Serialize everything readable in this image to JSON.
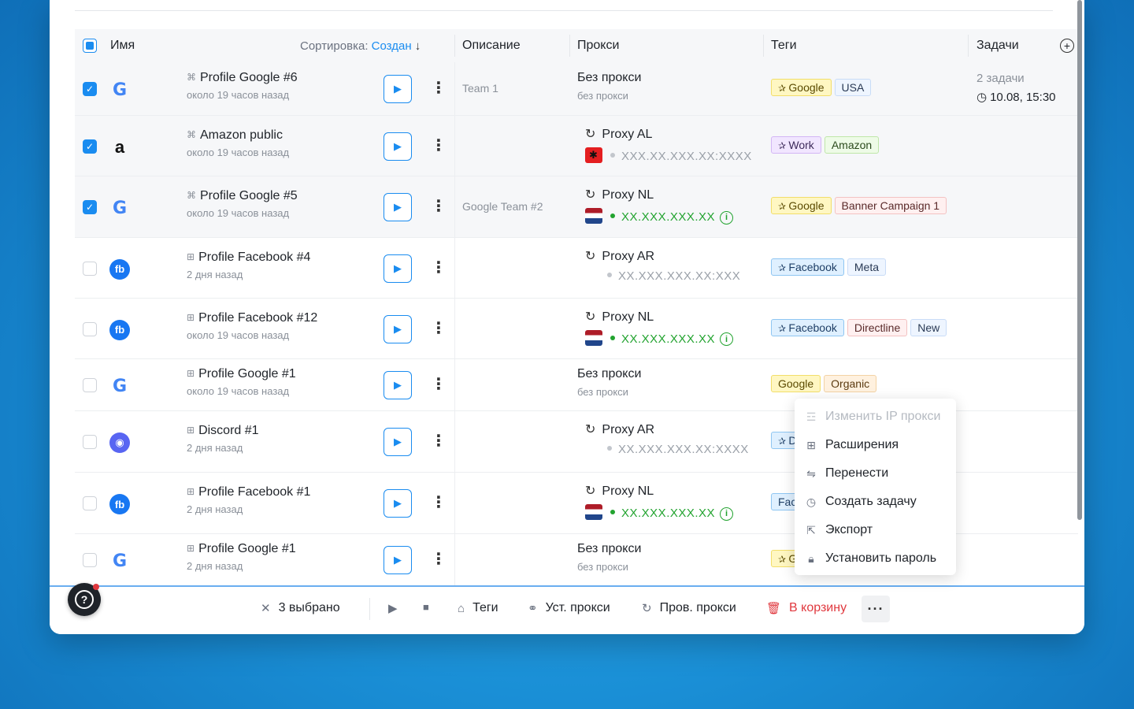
{
  "header": {
    "name": "Имя",
    "sort_label": "Сортировка:",
    "sort_value": "Создан",
    "sort_arrow": "↓",
    "description": "Описание",
    "proxy": "Прокси",
    "tags": "Теги",
    "tasks": "Задачи"
  },
  "rows": [
    {
      "checked": true,
      "logo": "google",
      "os": "mac",
      "name": "Profile Google #6",
      "time": "около 19 часов назад",
      "desc": "Team 1",
      "proxy_type": "none",
      "proxy_title": "Без прокси",
      "proxy_sub": "без прокси",
      "tags": [
        {
          "label": "Google",
          "pin": true,
          "color": "yellow"
        },
        {
          "label": "USA",
          "pin": false,
          "color": "blue"
        }
      ],
      "tasks_count": "2 задачи",
      "tasks_time": "10.08, 15:30"
    },
    {
      "checked": true,
      "logo": "amazon",
      "os": "mac",
      "name": "Amazon public",
      "time": "около 19 часов назад",
      "desc": "",
      "proxy_type": "proxy",
      "proxy_title": "Proxy AL",
      "flag": "al",
      "proxy_addr": "XXX.XX.XXX.XX:XXXX",
      "proxy_ok": false,
      "tags": [
        {
          "label": "Work",
          "pin": true,
          "color": "purple"
        },
        {
          "label": "Amazon",
          "pin": false,
          "color": "green"
        }
      ]
    },
    {
      "checked": true,
      "logo": "google",
      "os": "mac",
      "name": "Profile Google #5",
      "time": "около 19 часов назад",
      "desc": "Google Team #2",
      "proxy_type": "proxy",
      "proxy_title": "Proxy NL",
      "flag": "nl",
      "proxy_addr": "XX.XXX.XXX.XX",
      "proxy_ok": true,
      "tags": [
        {
          "label": "Google",
          "pin": true,
          "color": "yellow"
        },
        {
          "label": "Banner Campaign 1",
          "pin": false,
          "color": "red"
        }
      ]
    },
    {
      "checked": false,
      "logo": "facebook",
      "os": "win",
      "name": "Profile Facebook #4",
      "time": "2 дня назад",
      "desc": "",
      "proxy_type": "proxy",
      "proxy_title": "Proxy AR",
      "flag": "",
      "proxy_addr": "XX.XXX.XXX.XX:XXX",
      "proxy_ok": false,
      "tags": [
        {
          "label": "Facebook",
          "pin": true,
          "color": "sky"
        },
        {
          "label": "Meta",
          "pin": false,
          "color": "blue"
        }
      ]
    },
    {
      "checked": false,
      "logo": "facebook",
      "os": "win",
      "name": "Profile Facebook #12",
      "time": "около 19 часов назад",
      "desc": "",
      "proxy_type": "proxy",
      "proxy_title": "Proxy NL",
      "flag": "nl",
      "proxy_addr": "XX.XXX.XXX.XX",
      "proxy_ok": true,
      "tags": [
        {
          "label": "Facebook",
          "pin": true,
          "color": "sky"
        },
        {
          "label": "Directline",
          "pin": false,
          "color": "red"
        },
        {
          "label": "New",
          "pin": false,
          "color": "blue"
        }
      ]
    },
    {
      "checked": false,
      "logo": "google",
      "os": "win",
      "name": "Profile Google #1",
      "time": "около 19 часов назад",
      "desc": "",
      "proxy_type": "none",
      "proxy_title": "Без прокси",
      "proxy_sub": "без прокси",
      "tags": [
        {
          "label": "Google",
          "pin": false,
          "color": "yellow"
        },
        {
          "label": "Organic",
          "pin": false,
          "color": "orange"
        }
      ]
    },
    {
      "checked": false,
      "logo": "discord",
      "os": "win",
      "name": "Discord #1",
      "time": "2 дня назад",
      "desc": "",
      "proxy_type": "proxy",
      "proxy_title": "Proxy AR",
      "flag": "",
      "proxy_addr": "XX.XXX.XXX.XX:XXXX",
      "proxy_ok": false,
      "tags": [
        {
          "label": "D",
          "pin": true,
          "color": "sky"
        }
      ]
    },
    {
      "checked": false,
      "logo": "facebook",
      "os": "win",
      "name": "Profile Facebook #1",
      "time": "2 дня назад",
      "desc": "",
      "proxy_type": "proxy",
      "proxy_title": "Proxy NL",
      "flag": "nl",
      "proxy_addr": "XX.XXX.XXX.XX",
      "proxy_ok": true,
      "tags": [
        {
          "label": "Fac",
          "pin": false,
          "color": "sky"
        }
      ]
    },
    {
      "checked": false,
      "logo": "google",
      "os": "win",
      "name": "Profile Google #1",
      "time": "2 дня назад",
      "desc": "",
      "proxy_type": "none",
      "proxy_title": "Без прокси",
      "proxy_sub": "без прокси",
      "tags": [
        {
          "label": "G",
          "pin": true,
          "color": "yellow"
        }
      ]
    }
  ],
  "context_menu": [
    {
      "label": "Изменить IP прокси",
      "icon": "ip-icon",
      "glyph": "☲",
      "disabled": true
    },
    {
      "label": "Расширения",
      "icon": "extensions-icon",
      "glyph": "⊞",
      "disabled": false
    },
    {
      "label": "Перенести",
      "icon": "transfer-icon",
      "glyph": "⇋",
      "disabled": false
    },
    {
      "label": "Создать задачу",
      "icon": "clock-icon",
      "glyph": "◷",
      "disabled": false
    },
    {
      "label": "Экспорт",
      "icon": "export-icon",
      "glyph": "⇱",
      "disabled": false
    },
    {
      "label": "Установить пароль",
      "icon": "lock-icon",
      "glyph": "🔒︎",
      "disabled": false
    }
  ],
  "bottom_bar": {
    "selected": "3 выбрано",
    "tags": "Теги",
    "set_proxy": "Уст. прокси",
    "check_proxy": "Пров. прокси",
    "trash": "В корзину",
    "more": "···"
  },
  "help": "?",
  "colors": {
    "accent": "#1a8cf0",
    "danger": "#e0383e",
    "success": "#22a32f"
  }
}
